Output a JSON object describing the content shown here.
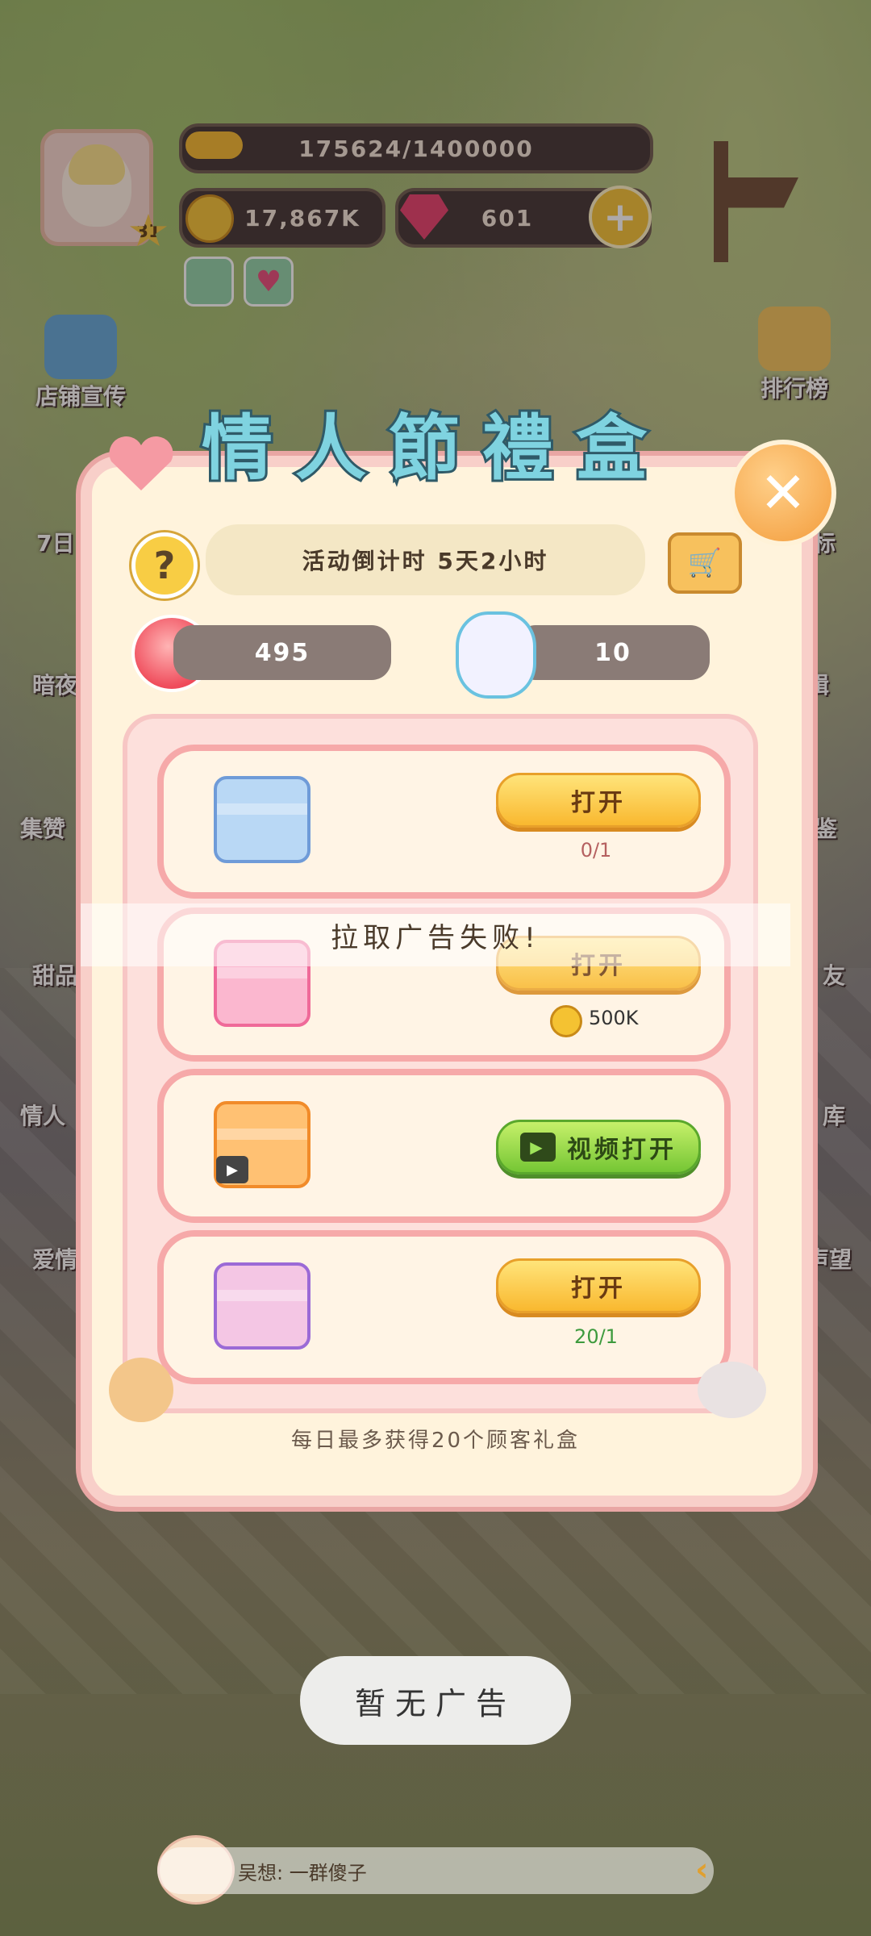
{
  "hud": {
    "exp": "175624/1400000",
    "exp_fraction": 0.125,
    "coins": "17,867K",
    "gems": "601",
    "level": "31"
  },
  "side_left": [
    "店铺宣传",
    "7日",
    "暗夜",
    "集赞",
    "甜品",
    "情人",
    "爱情"
  ],
  "side_right": [
    "排行榜",
    "目标",
    "辑",
    "鉴",
    "友",
    "库",
    "声望"
  ],
  "modal": {
    "title": "情人節禮盒",
    "countdown": "活动倒计时 5天2小时",
    "roses": "495",
    "tokens": "10",
    "rows": [
      {
        "button": "打开",
        "sub": "0/1",
        "sub_color": "#b56060"
      },
      {
        "button": "打开",
        "sub": "500K",
        "sub_color": "#333333"
      },
      {
        "button": "视频打开",
        "sub": "",
        "sub_color": "#333333"
      },
      {
        "button": "打开",
        "sub": "20/1",
        "sub_color": "#3d9a3d"
      }
    ],
    "error": "拉取广告失败!",
    "footer": "每日最多获得20个顾客礼盒"
  },
  "toast": "暂无广告",
  "chat": "吴想: 一群傻子",
  "colors": {
    "modal_bg": "#fff3dc",
    "modal_border": "#f8cfc9",
    "button_yellow": "#f9b82f",
    "button_green": "#75c634"
  }
}
